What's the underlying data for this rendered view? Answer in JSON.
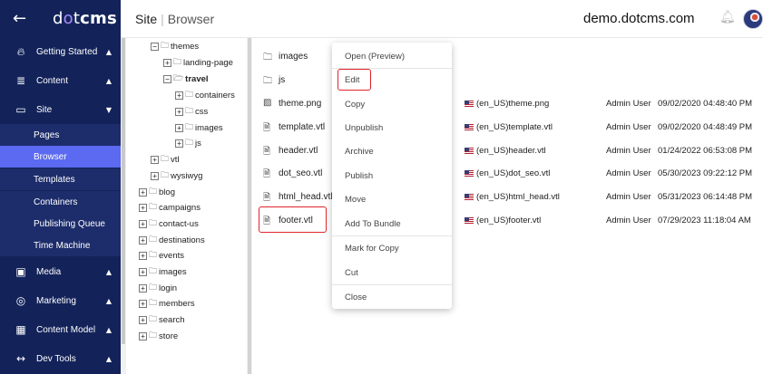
{
  "sidebar": {
    "brand": {
      "prefix": "d",
      "dot": "o",
      "mid": "t",
      "strong": "cms"
    },
    "sections": [
      {
        "icon": "fire",
        "label": "Getting Started",
        "chev": "▲"
      },
      {
        "icon": "list",
        "label": "Content",
        "chev": "▲"
      },
      {
        "icon": "folder",
        "label": "Site",
        "chev": "▼"
      },
      {
        "icon": "image",
        "label": "Media",
        "chev": "▲"
      },
      {
        "icon": "target",
        "label": "Marketing",
        "chev": "▲"
      },
      {
        "icon": "grid",
        "label": "Content Model",
        "chev": "▲"
      },
      {
        "icon": "code",
        "label": "Dev Tools",
        "chev": "▲"
      }
    ],
    "site_items": [
      "Pages",
      "Browser",
      "Templates",
      "Containers",
      "Publishing Queue",
      "Time Machine"
    ],
    "active_item": "Browser"
  },
  "topbar": {
    "crumb_root": "Site",
    "crumb_current": "Browser",
    "host": "demo.dotcms.com"
  },
  "tree": [
    {
      "label": "themes",
      "expander": "⊟",
      "open": true,
      "bold": false
    },
    {
      "label": "landing-page",
      "expander": "⊞",
      "open": false,
      "bold": false
    },
    {
      "label": "travel",
      "expander": "⊟",
      "open": true,
      "bold": true
    },
    {
      "label": "containers",
      "expander": "⊞",
      "open": false,
      "bold": false
    },
    {
      "label": "css",
      "expander": "⊞",
      "open": false,
      "bold": false
    },
    {
      "label": "images",
      "expander": "⊞",
      "open": false,
      "bold": false
    },
    {
      "label": "js",
      "expander": "⊞",
      "open": false,
      "bold": false
    },
    {
      "label": "vtl",
      "expander": "⊞",
      "open": false,
      "bold": false
    },
    {
      "label": "wysiwyg",
      "expander": "⊞",
      "open": false,
      "bold": false
    },
    {
      "label": "blog",
      "expander": "⊞",
      "open": false,
      "bold": false
    },
    {
      "label": "campaigns",
      "expander": "⊞",
      "open": false,
      "bold": false
    },
    {
      "label": "contact-us",
      "expander": "⊞",
      "open": false,
      "bold": false
    },
    {
      "label": "destinations",
      "expander": "⊞",
      "open": false,
      "bold": false
    },
    {
      "label": "events",
      "expander": "⊞",
      "open": false,
      "bold": false
    },
    {
      "label": "images",
      "expander": "⊞",
      "open": false,
      "bold": false
    },
    {
      "label": "login",
      "expander": "⊞",
      "open": false,
      "bold": false
    },
    {
      "label": "members",
      "expander": "⊞",
      "open": false,
      "bold": false
    },
    {
      "label": "search",
      "expander": "⊞",
      "open": false,
      "bold": false
    },
    {
      "label": "store",
      "expander": "⊞",
      "open": false,
      "bold": false
    }
  ],
  "files": [
    {
      "icon": "folder",
      "name": "images",
      "lang": "",
      "user": "",
      "date": ""
    },
    {
      "icon": "folder",
      "name": "js",
      "lang": "",
      "user": "",
      "date": ""
    },
    {
      "icon": "image",
      "name": "theme.png",
      "lang": "(en_US)theme.png",
      "user": "Admin User",
      "date": "09/02/2020 04:48:40 PM"
    },
    {
      "icon": "file",
      "name": "template.vtl",
      "lang": "(en_US)template.vtl",
      "user": "Admin User",
      "date": "09/02/2020 04:48:49 PM"
    },
    {
      "icon": "file",
      "name": "header.vtl",
      "lang": "(en_US)header.vtl",
      "user": "Admin User",
      "date": "01/24/2022 06:53:08 PM"
    },
    {
      "icon": "file",
      "name": "dot_seo.vtl",
      "lang": "(en_US)dot_seo.vtl",
      "user": "Admin User",
      "date": "05/30/2023 09:22:12 PM"
    },
    {
      "icon": "file",
      "name": "html_head.vtl",
      "lang": "(en_US)html_head.vtl",
      "user": "Admin User",
      "date": "05/31/2023 06:14:48 PM"
    },
    {
      "icon": "file",
      "name": "footer.vtl",
      "lang": "(en_US)footer.vtl",
      "user": "Admin User",
      "date": "07/29/2023 11:18:04 AM"
    }
  ],
  "selected_file": "footer.vtl",
  "context_menu": {
    "items": [
      "Open (Preview)",
      "Edit",
      "Copy",
      "Unpublish",
      "Archive",
      "Publish",
      "Move",
      "Add To Bundle",
      "Mark for Copy",
      "Cut",
      "Close"
    ],
    "highlighted": "Edit"
  },
  "colors": {
    "sidebar_bg": "#13235a",
    "sidebar_active": "#5b6af0",
    "highlight_border": "#e0242b"
  }
}
